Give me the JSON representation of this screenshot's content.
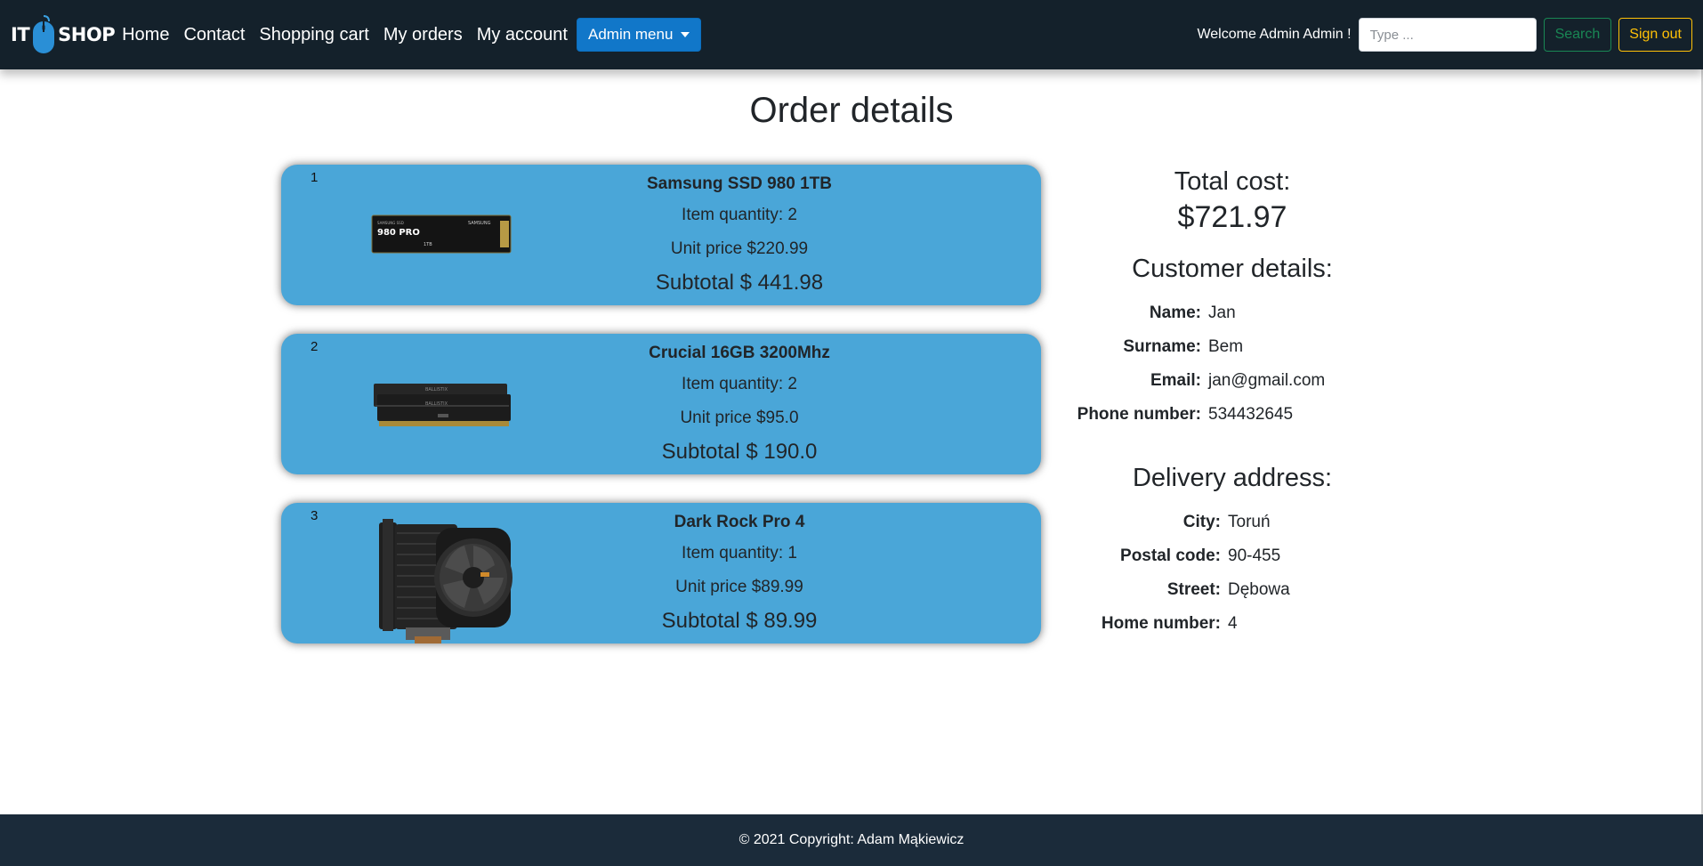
{
  "nav": {
    "logo_left": "IT",
    "logo_right": "SHOP",
    "links": [
      "Home",
      "Contact",
      "Shopping cart",
      "My orders",
      "My account"
    ],
    "admin_menu": "Admin menu",
    "welcome": "Welcome Admin Admin !",
    "search_placeholder": "Type ...",
    "search_button": "Search",
    "signout_button": "Sign out",
    "colors": {
      "bg": "#14212b",
      "admin": "#1177c9",
      "search": "#198754",
      "signout": "#ffc107"
    }
  },
  "page": {
    "title": "Order details"
  },
  "items": [
    {
      "index": "1",
      "name": "Samsung SSD 980 1TB",
      "quantity": "Item quantity: 2",
      "unit_price": "Unit price $220.99",
      "subtotal": "Subtotal $ 441.98",
      "image": "ssd-image"
    },
    {
      "index": "2",
      "name": "Crucial 16GB 3200Mhz",
      "quantity": "Item quantity: 2",
      "unit_price": "Unit price $95.0",
      "subtotal": "Subtotal $ 190.0",
      "image": "ram-image"
    },
    {
      "index": "3",
      "name": "Dark Rock Pro 4",
      "quantity": "Item quantity: 1",
      "unit_price": "Unit price $89.99",
      "subtotal": "Subtotal $ 89.99",
      "image": "cooler-image"
    }
  ],
  "summary": {
    "total_label": "Total cost:",
    "total_value": "$721.97",
    "customer_title": "Customer details:",
    "customer": [
      {
        "k": "Name:",
        "v": "Jan"
      },
      {
        "k": "Surname:",
        "v": "Bem"
      },
      {
        "k": "Email:",
        "v": "jan@gmail.com"
      },
      {
        "k": "Phone number:",
        "v": "534432645"
      }
    ],
    "address_title": "Delivery address:",
    "address": [
      {
        "k": "City:",
        "v": "Toruń"
      },
      {
        "k": "Postal code:",
        "v": "90-455"
      },
      {
        "k": "Street:",
        "v": "Dębowa"
      },
      {
        "k": "Home number:",
        "v": "4"
      }
    ]
  },
  "footer": {
    "text": "© 2021 Copyright: Adam Mąkiewicz"
  },
  "ssd_label": "980 PRO"
}
